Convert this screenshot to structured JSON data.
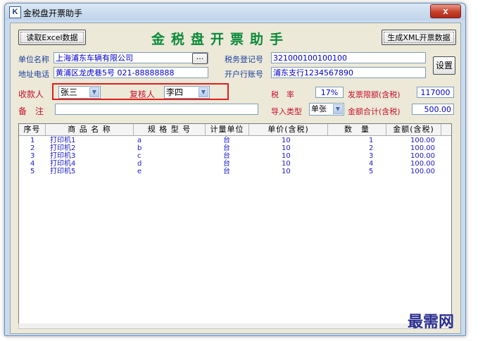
{
  "window": {
    "title": "金税盘开票助手",
    "icon_letter": "K",
    "close_label": "x"
  },
  "toolbar": {
    "read_excel_label": "读取Excel数据",
    "heading": "金税盘开票助手",
    "gen_xml_label": "生成XML开票数据",
    "settings_label": "设置"
  },
  "form": {
    "company_label": "单位名称",
    "company_value": "上海浦东车辆有限公司",
    "lookup_label": "...",
    "address_label": "地址电话",
    "address_value": "黄浦区龙虎巷5号 021-88888888",
    "tax_reg_label": "税务登记号",
    "tax_reg_value": "321000100100100",
    "bank_label": "开户行账号",
    "bank_value": "浦东支行1234567890",
    "payee_label": "收款人",
    "payee_value": "张三",
    "reviewer_label": "复核人",
    "reviewer_value": "李四",
    "tax_rate_label": "税　率",
    "tax_rate_value": "17%",
    "limit_label": "发票限额(含税)",
    "limit_value": "117000",
    "remark_label": "备　注",
    "remark_value": "",
    "import_type_label": "导入类型",
    "import_type_value": "单张",
    "total_label": "金额合计(含税)",
    "total_value": "500.00"
  },
  "table": {
    "headers": [
      "序号",
      "商 品 名 称",
      "规 格 型 号",
      "计量单位",
      "单价(含税)",
      "数　量",
      "金额(含税)"
    ],
    "rows": [
      [
        "1",
        "打印机1",
        "a",
        "台",
        "10",
        "1",
        "100.00"
      ],
      [
        "2",
        "打印机2",
        "b",
        "台",
        "10",
        "2",
        "100.00"
      ],
      [
        "3",
        "打印机3",
        "c",
        "台",
        "10",
        "3",
        "100.00"
      ],
      [
        "4",
        "打印机4",
        "d",
        "台",
        "10",
        "4",
        "100.00"
      ],
      [
        "5",
        "打印机5",
        "e",
        "台",
        "10",
        "5",
        "100.00"
      ]
    ]
  },
  "watermark": "最需网",
  "colors": {
    "heading": "#0a8a3a",
    "label_red": "#c8102e",
    "value_blue": "#0000cc",
    "highlight": "#e21d1d"
  }
}
